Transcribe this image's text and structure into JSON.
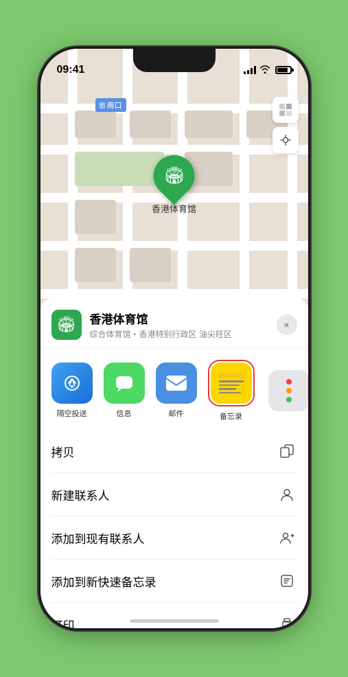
{
  "status": {
    "time": "09:41",
    "location_arrow": "▶"
  },
  "map": {
    "label": "南口",
    "pin_label": "香港体育馆",
    "pin_emoji": "🏟"
  },
  "venue": {
    "name": "香港体育馆",
    "description": "综合体育馆・香港特别行政区 油尖旺区"
  },
  "share_items": [
    {
      "id": "airdrop",
      "label": "隔空投送"
    },
    {
      "id": "messages",
      "label": "信息"
    },
    {
      "id": "mail",
      "label": "邮件"
    },
    {
      "id": "notes",
      "label": "备忘录"
    }
  ],
  "actions": [
    {
      "id": "copy",
      "label": "拷贝",
      "icon": "⊞"
    },
    {
      "id": "new-contact",
      "label": "新建联系人",
      "icon": "👤"
    },
    {
      "id": "add-existing-contact",
      "label": "添加到现有联系人",
      "icon": "👥"
    },
    {
      "id": "quick-note",
      "label": "添加到新快速备忘录",
      "icon": "📝"
    },
    {
      "id": "print",
      "label": "打印",
      "icon": "🖨"
    }
  ],
  "close_label": "×"
}
